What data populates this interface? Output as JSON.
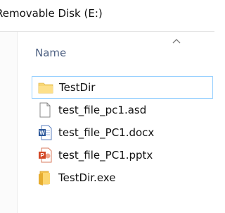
{
  "window": {
    "title": "Removable Disk (E:)"
  },
  "header": {
    "name_column": "Name"
  },
  "files": [
    {
      "name": "TestDir",
      "icon": "folder-icon"
    },
    {
      "name": "test_file_pc1.asd",
      "icon": "generic-file-icon"
    },
    {
      "name": "test_file_PC1.docx",
      "icon": "word-document-icon"
    },
    {
      "name": "test_file_PC1.pptx",
      "icon": "powerpoint-document-icon"
    },
    {
      "name": "TestDir.exe",
      "icon": "folder-exe-icon"
    }
  ],
  "colors": {
    "header_text": "#4d6082",
    "selection_border": "#99d1ff",
    "folder_yellow": "#f8d775",
    "word_blue": "#2b579a",
    "ppt_red": "#d24726"
  }
}
